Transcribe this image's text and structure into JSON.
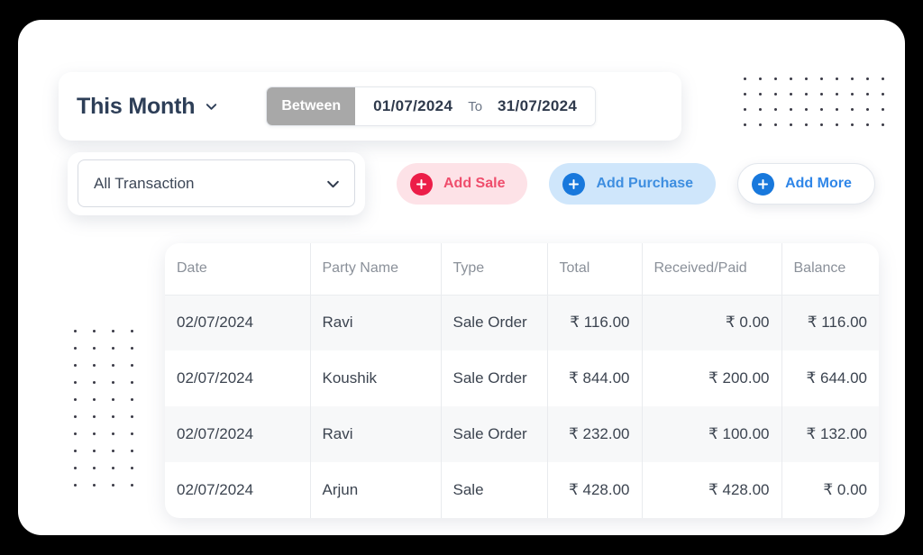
{
  "filters": {
    "period_label": "This Month",
    "period_chevron_icon": "chevron-down-icon",
    "between_label": "Between",
    "date_from": "01/07/2024",
    "to_label": "To",
    "date_to": "31/07/2024",
    "transaction_type": "All Transaction",
    "type_chevron_icon": "chevron-down-icon"
  },
  "actions": [
    {
      "label": "Add Sale",
      "icon": "plus-circle-icon",
      "accent": "#ec1d48",
      "bg": "#fde2e7"
    },
    {
      "label": "Add Purchase",
      "icon": "plus-circle-icon",
      "accent": "#1878dc",
      "bg": "#cfe6fb"
    },
    {
      "label": "Add More",
      "icon": "plus-circle-icon",
      "accent": "#1878dc",
      "bg": "#ffffff"
    }
  ],
  "table": {
    "columns": [
      "Date",
      "Party Name",
      "Type",
      "Total",
      "Received/Paid",
      "Balance"
    ],
    "rows": [
      {
        "date": "02/07/2024",
        "party": "Ravi",
        "type": "Sale Order",
        "total": "₹ 116.00",
        "received": "₹ 0.00",
        "balance": "₹ 116.00"
      },
      {
        "date": "02/07/2024",
        "party": "Koushik",
        "type": "Sale Order",
        "total": "₹ 844.00",
        "received": "₹ 200.00",
        "balance": "₹ 644.00"
      },
      {
        "date": "02/07/2024",
        "party": "Ravi",
        "type": "Sale Order",
        "total": "₹ 232.00",
        "received": "₹ 100.00",
        "balance": "₹ 132.00"
      },
      {
        "date": "02/07/2024",
        "party": "Arjun",
        "type": "Sale",
        "total": "₹ 428.00",
        "received": "₹ 428.00",
        "balance": "₹ 0.00"
      }
    ]
  },
  "decor": {
    "dots_top_right": {
      "cols": 10,
      "rows": 4,
      "color": "#3a3a46"
    },
    "dots_left": {
      "cols": 4,
      "rows": 10,
      "color": "#3a3a46"
    }
  }
}
